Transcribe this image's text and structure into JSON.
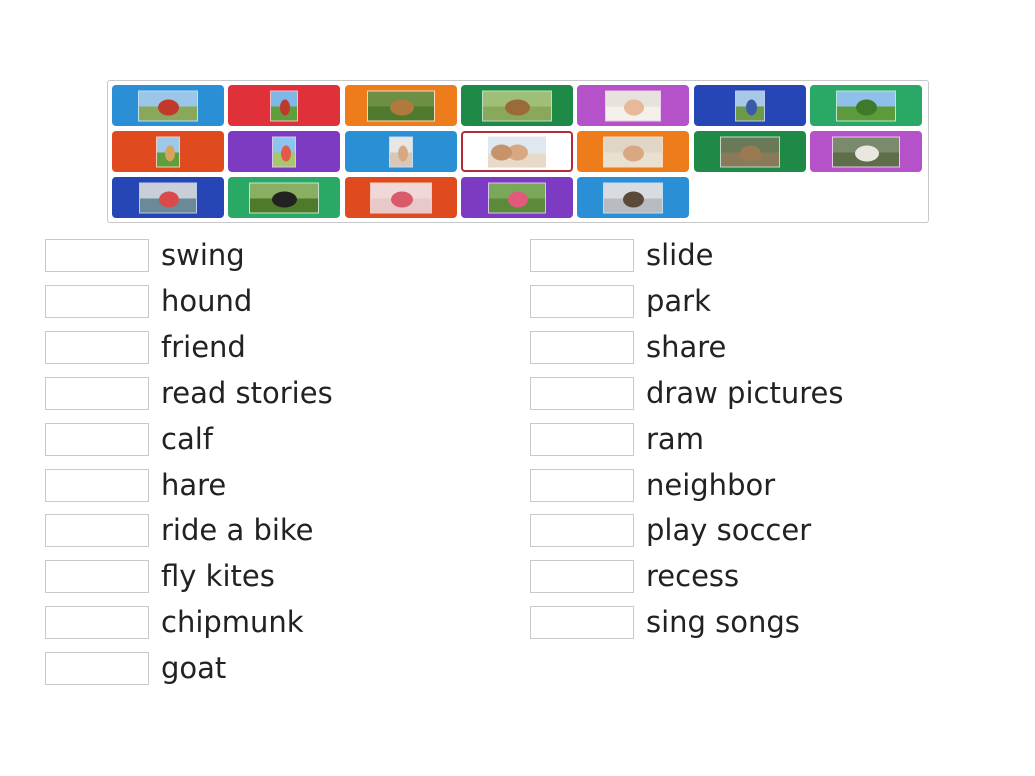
{
  "image_tiles": [
    {
      "color": "#2b8fd6",
      "icon": "swing-photo-icon"
    },
    {
      "color": "#e0303a",
      "icon": "slide-photo-icon"
    },
    {
      "color": "#ef7c1a",
      "icon": "hound-photo-icon"
    },
    {
      "color": "#1f8a48",
      "icon": "hare-photo-icon"
    },
    {
      "color": "#b552c9",
      "icon": "read-stories-photo-icon"
    },
    {
      "color": "#2546b4",
      "icon": "ride-bike-photo-icon"
    },
    {
      "color": "#2aa866",
      "icon": "park-photo-icon"
    },
    {
      "color": "#e04a1f",
      "icon": "play-photo-icon"
    },
    {
      "color": "#7d3bc4",
      "icon": "fly-kites-photo-icon"
    },
    {
      "color": "#2b8fd6",
      "icon": "boy-photo-icon"
    },
    {
      "color": "#ffffff",
      "icon": "friends-photo-icon",
      "selected": true
    },
    {
      "color": "#ef7c1a",
      "icon": "share-photo-icon"
    },
    {
      "color": "#1f8a48",
      "icon": "chipmunk-photo-icon"
    },
    {
      "color": "#b552c9",
      "icon": "goat-photo-icon"
    },
    {
      "color": "#2546b4",
      "icon": "soccer-photo-icon"
    },
    {
      "color": "#2aa866",
      "icon": "calf-photo-icon"
    },
    {
      "color": "#e04a1f",
      "icon": "draw-pictures-photo-icon"
    },
    {
      "color": "#7d3bc4",
      "icon": "neighbor-photo-icon"
    },
    {
      "color": "#2b8fd6",
      "icon": "ram-photo-icon"
    }
  ],
  "left_words": [
    "swing",
    "hound",
    "friend",
    "read stories",
    "calf",
    "hare",
    "ride a bike",
    "fly kites",
    "chipmunk",
    "goat"
  ],
  "right_words": [
    "slide",
    "park",
    "share",
    "draw pictures",
    "ram",
    "neighbor",
    "play soccer",
    "recess",
    "sing songs"
  ]
}
